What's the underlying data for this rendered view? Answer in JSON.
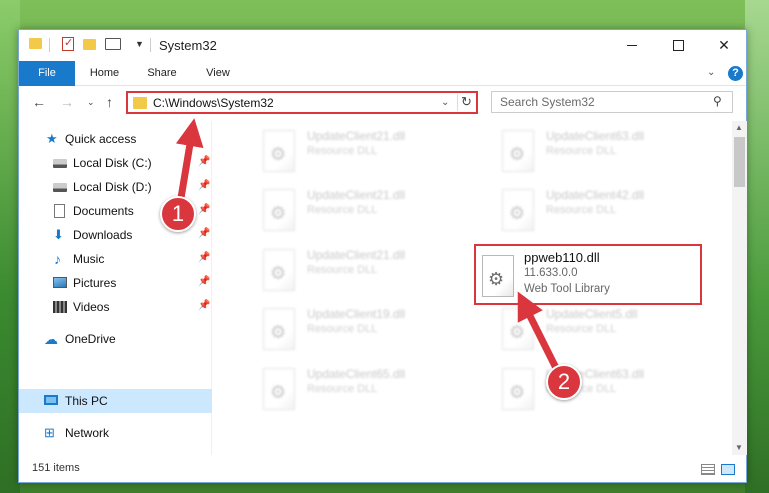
{
  "window": {
    "title": "System32",
    "controls": {
      "close": "✕"
    }
  },
  "ribbon": {
    "tabs": [
      "File",
      "Home",
      "Share",
      "View"
    ],
    "help_label": "?"
  },
  "address": {
    "path": "C:\\Windows\\System32"
  },
  "search": {
    "placeholder": "Search System32"
  },
  "sidebar": {
    "items": [
      {
        "label": "Quick access",
        "icon": "star-icon",
        "pinned": false
      },
      {
        "label": "Local Disk (C:)",
        "icon": "disk-icon",
        "pinned": true
      },
      {
        "label": "Local Disk (D:)",
        "icon": "disk-icon",
        "pinned": true
      },
      {
        "label": "Documents",
        "icon": "document-icon",
        "pinned": true
      },
      {
        "label": "Downloads",
        "icon": "download-icon",
        "pinned": true
      },
      {
        "label": "Music",
        "icon": "music-icon",
        "pinned": true
      },
      {
        "label": "Pictures",
        "icon": "picture-icon",
        "pinned": true
      },
      {
        "label": "Videos",
        "icon": "video-icon",
        "pinned": true
      },
      {
        "label": "OneDrive",
        "icon": "cloud-icon",
        "pinned": false
      },
      {
        "label": "This PC",
        "icon": "pc-icon",
        "pinned": false,
        "selected": true
      },
      {
        "label": "Network",
        "icon": "network-icon",
        "pinned": false
      }
    ]
  },
  "files": [
    {
      "name": "UpdateClient21.dll",
      "type": "Resource DLL"
    },
    {
      "name": "UpdateClient63.dll",
      "type": "Resource DLL"
    },
    {
      "name": "UpdateClient21.dll",
      "type": "Resource DLL"
    },
    {
      "name": "UpdateClient42.dll",
      "type": "Resource DLL"
    },
    {
      "name": "UpdateClient21.dll",
      "type": "Resource DLL"
    },
    {
      "name": "UpdateClient19.dll",
      "type": "Resource DLL"
    },
    {
      "name": "UpdateClient5.dll",
      "type": "Resource DLL"
    },
    {
      "name": "UpdateClient65.dll",
      "type": "Resource DLL"
    },
    {
      "name": "UpdateClient63.dll",
      "type": "Resource DLL"
    }
  ],
  "highlighted_file": {
    "name": "ppweb110.dll",
    "version": "11.633.0.0",
    "description": "Web Tool Library"
  },
  "status": {
    "item_count": "151 items"
  },
  "annotations": {
    "step1": "1",
    "step2": "2",
    "color": "#d9363e"
  }
}
